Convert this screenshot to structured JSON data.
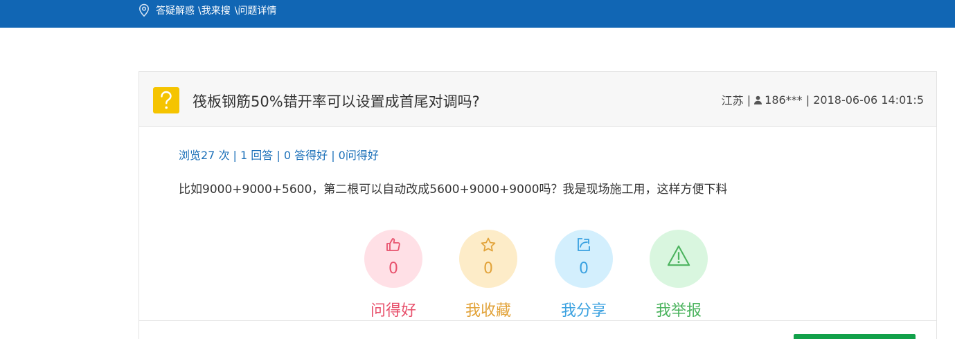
{
  "breadcrumb": {
    "items": [
      "答疑解惑",
      "\\我来搜",
      "\\问题详情"
    ]
  },
  "question": {
    "title": "筏板钢筋50%错开率可以设置成首尾对调吗?",
    "region": "江苏",
    "user": "186***",
    "time": "2018-06-06 14:01:5",
    "stats": "浏览27 次 | 1 回答 | 0 答得好 | 0问得好",
    "body": "比如9000+9000+5600，第二根可以自动改成5600+9000+9000吗？我是现场施工用，这样方便下料"
  },
  "actions": [
    {
      "icon": "thumbs-up-icon",
      "count": "0",
      "label": "问得好",
      "color": "#e8526d"
    },
    {
      "icon": "star-icon",
      "count": "0",
      "label": "我收藏",
      "color": "#e2a33a"
    },
    {
      "icon": "share-icon",
      "count": "0",
      "label": "我分享",
      "color": "#3aa1e0"
    },
    {
      "icon": "warning-icon",
      "count": "",
      "label": "我举报",
      "color": "#4bb35e"
    }
  ],
  "colors": {
    "topbar": "#1166b4",
    "stats_link": "#1a6fb8",
    "question_icon": "#f5c400",
    "answer_button": "#12a14a"
  }
}
